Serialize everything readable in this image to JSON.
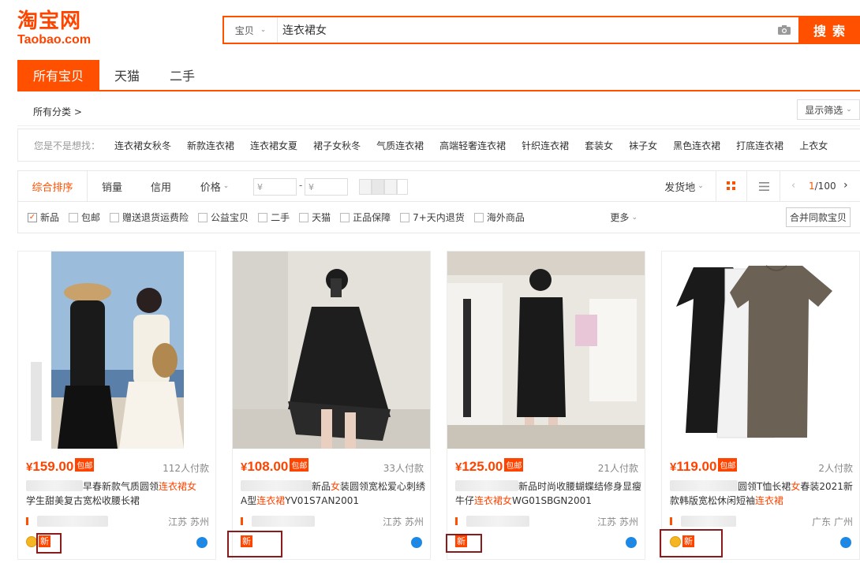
{
  "header": {
    "logo_cn": "淘宝网",
    "logo_en": "Taobao.com",
    "search_type": "宝贝",
    "search_value": "连衣裙女",
    "search_button": "搜索",
    "brand_color": "#ff5000"
  },
  "top_tabs": [
    "所有宝贝",
    "天猫",
    "二手"
  ],
  "category": {
    "label": "所有分类 >",
    "filter_button": "显示筛选"
  },
  "suggest": {
    "label": "您是不是想找：",
    "items": [
      "连衣裙女秋冬",
      "新款连衣裙",
      "连衣裙女夏",
      "裙子女秋冬",
      "气质连衣裙",
      "高端轻奢连衣裙",
      "针织连衣裙",
      "套装女",
      "袜子女",
      "黑色连衣裙",
      "打底连衣裙",
      "上衣女"
    ]
  },
  "sort": {
    "tabs": [
      "综合排序",
      "销量",
      "信用",
      "价格"
    ],
    "price_min_placeholder": "¥",
    "price_max_placeholder": "¥",
    "price_dash": "-",
    "ship_from": "发货地",
    "page": "1",
    "page_total": "/100"
  },
  "filters": {
    "items": [
      {
        "label": "新品",
        "checked": true
      },
      {
        "label": "包邮",
        "checked": false
      },
      {
        "label": "赠送退货运费险",
        "checked": false
      },
      {
        "label": "公益宝贝",
        "checked": false
      },
      {
        "label": "二手",
        "checked": false
      },
      {
        "label": "天猫",
        "checked": false
      },
      {
        "label": "正品保障",
        "checked": false
      },
      {
        "label": "7+天内退货",
        "checked": false
      },
      {
        "label": "海外商品",
        "checked": false
      }
    ],
    "more": "更多",
    "merge": "合并同款宝贝"
  },
  "products": [
    {
      "currency": "¥",
      "price": "159.00",
      "baoyou": "包邮",
      "sales": "112人付款",
      "title_pre": "早春新款气质圆领",
      "title_hl": "连衣裙女",
      "title_post": "学生甜美复古宽松收腰长裙",
      "location": "江苏 苏州",
      "new_badge": "新",
      "has_coin": true
    },
    {
      "currency": "¥",
      "price": "108.00",
      "baoyou": "包邮",
      "sales": "33人付款",
      "title_pre": "新品",
      "title_hl": "女",
      "title_post": "装圆领宽松爱心刺绣A型",
      "title_hl2": "连衣裙",
      "title_post2": "YV01S7AN2001",
      "location": "江苏 苏州",
      "new_badge": "新",
      "has_coin": false
    },
    {
      "currency": "¥",
      "price": "125.00",
      "baoyou": "包邮",
      "sales": "21人付款",
      "title_pre": "新品时尚收腰蝴蝶结修身显瘦牛仔",
      "title_hl": "连衣裙女",
      "title_post": "WG01SBGN2001",
      "location": "江苏 苏州",
      "new_badge": "新",
      "has_coin": false
    },
    {
      "currency": "¥",
      "price": "119.00",
      "baoyou": "包邮",
      "sales": "2人付款",
      "title_pre": "圆领T恤长裙",
      "title_hl": "女",
      "title_post": "春装2021新款韩版宽松休闲短袖",
      "title_hl2": "连衣裙",
      "title_post2": "",
      "location": "广东 广州",
      "new_badge": "新",
      "has_coin": true
    }
  ]
}
